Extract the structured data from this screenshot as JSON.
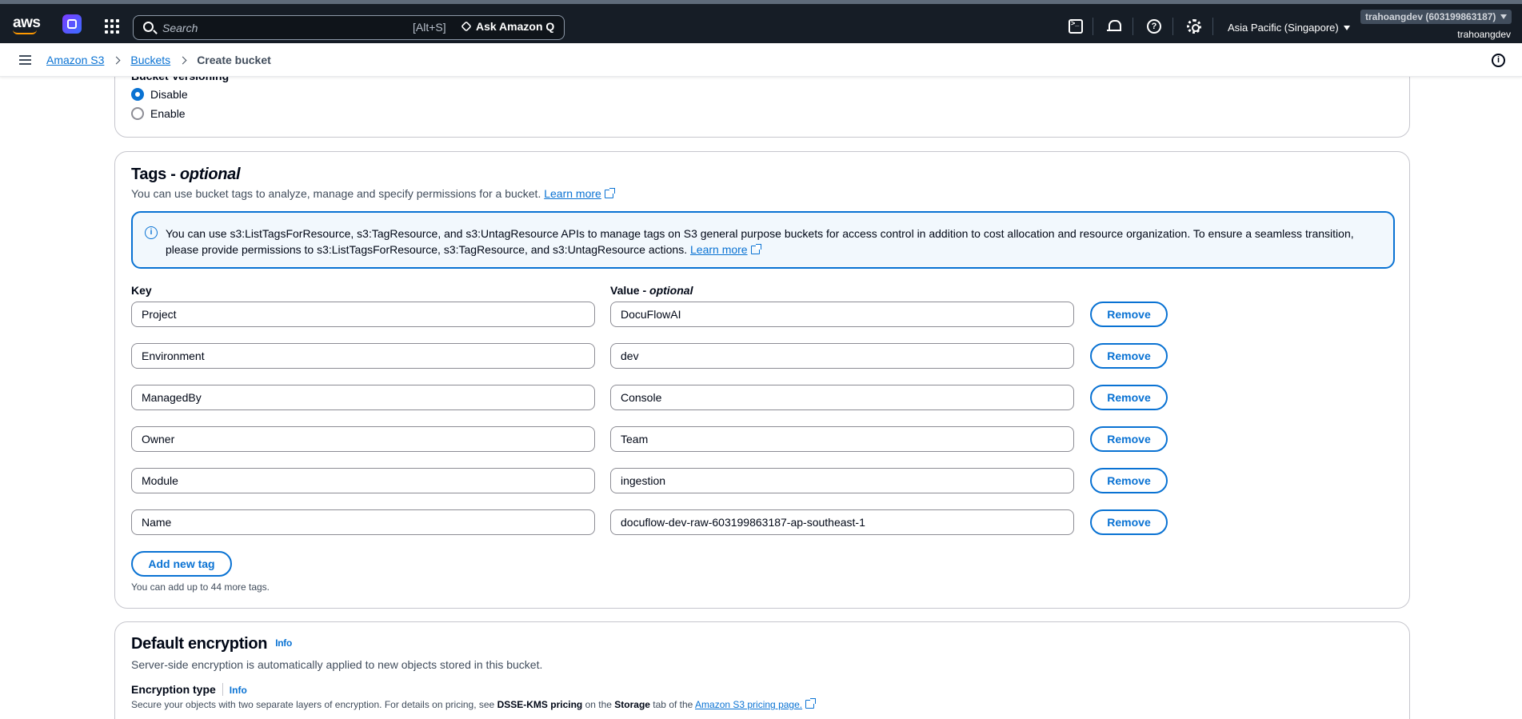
{
  "topnav": {
    "logo": "aws",
    "search_placeholder": "Search",
    "search_shortcut": "[Alt+S]",
    "ask_q": "Ask Amazon Q",
    "region": "Asia Pacific (Singapore)",
    "account": "trahoangdev (603199863187)",
    "user": "trahoangdev",
    "icons": [
      "cloudshell-icon",
      "bell-icon",
      "help-icon",
      "gear-icon"
    ]
  },
  "breadcrumb": {
    "items": [
      "Amazon S3",
      "Buckets"
    ],
    "current": "Create bucket"
  },
  "versioning": {
    "label": "Bucket Versioning",
    "options": [
      "Disable",
      "Enable"
    ],
    "selected": "Disable"
  },
  "tags": {
    "title": "Tags - ",
    "title_em": "optional",
    "description": "You can use bucket tags to analyze, manage and specify permissions for a bucket.",
    "learn_more": "Learn more",
    "alert_text": "You can use s3:ListTagsForResource, s3:TagResource, and s3:UntagResource APIs to manage tags on S3 general purpose buckets for access control in addition to cost allocation and resource organization. To ensure a seamless transition, please provide permissions to s3:ListTagsForResource, s3:TagResource, and s3:UntagResource actions.",
    "alert_link": "Learn more",
    "key_header": "Key",
    "value_header": "Value - ",
    "value_header_em": "optional",
    "rows": [
      {
        "key": "Project",
        "value": "DocuFlowAI"
      },
      {
        "key": "Environment",
        "value": "dev"
      },
      {
        "key": "ManagedBy",
        "value": "Console"
      },
      {
        "key": "Owner",
        "value": "Team"
      },
      {
        "key": "Module",
        "value": "ingestion"
      },
      {
        "key": "Name",
        "value": "docuflow-dev-raw-603199863187-ap-southeast-1"
      }
    ],
    "remove_label": "Remove",
    "add_label": "Add new tag",
    "limit_text": "You can add up to 44 more tags."
  },
  "encryption": {
    "title": "Default encryption",
    "info": "Info",
    "description": "Server-side encryption is automatically applied to new objects stored in this bucket.",
    "type_label": "Encryption type",
    "type_info": "Info",
    "type_desc_1": "Secure your objects with two separate layers of encryption. For details on pricing, see ",
    "type_desc_b1": "DSSE-KMS pricing",
    "type_desc_2": " on the ",
    "type_desc_b2": "Storage",
    "type_desc_3": " tab of the ",
    "type_desc_link": "Amazon S3 pricing page."
  }
}
